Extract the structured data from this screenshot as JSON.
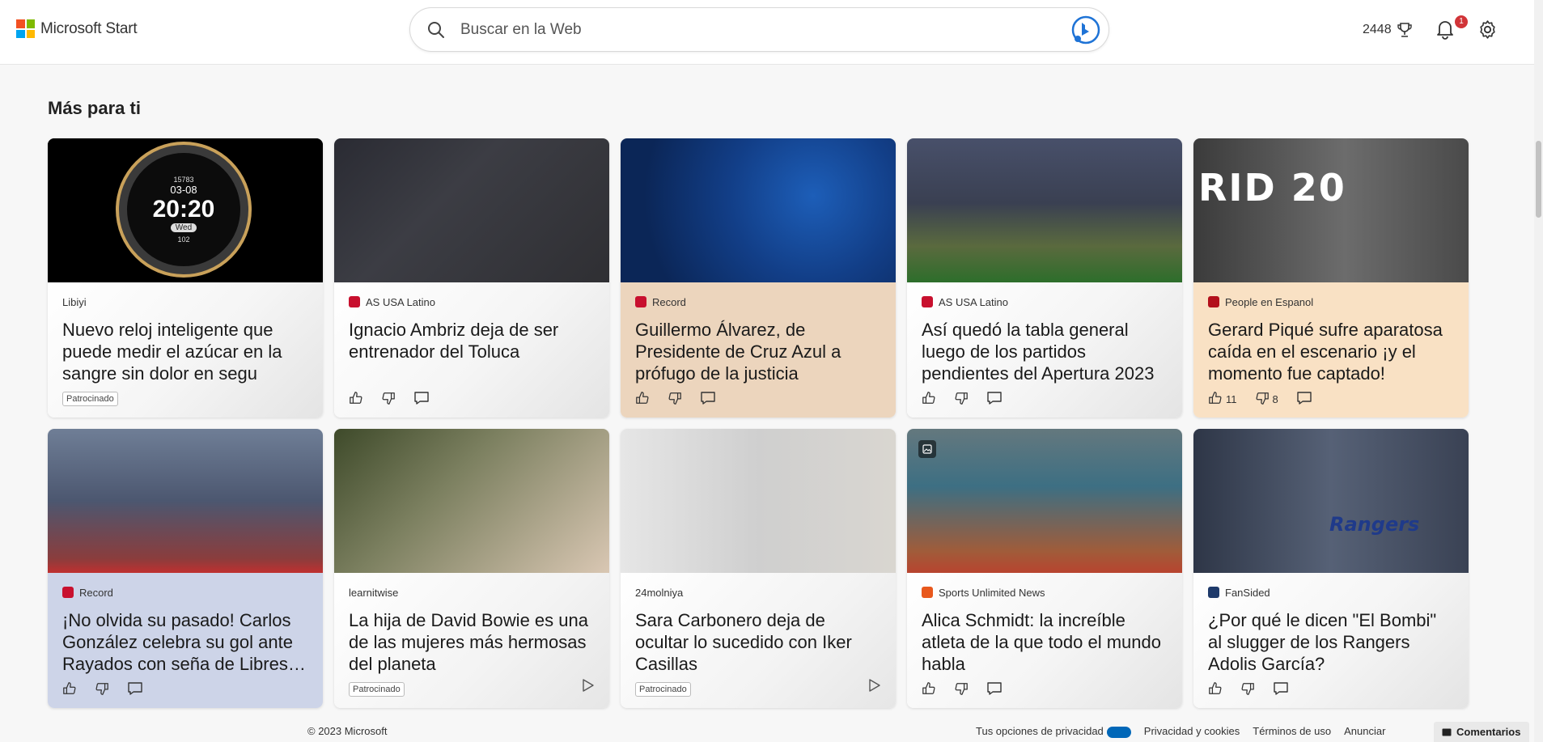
{
  "header": {
    "brand": "Microsoft Start",
    "search_placeholder": "Buscar en la Web",
    "points": "2448",
    "notification_count": "1"
  },
  "section_title": "Más para ti",
  "cards": [
    {
      "source": "Libiyi",
      "headline": "Nuevo reloj inteligente que puede medir el azúcar en la sangre sin dolor en segu",
      "sponsored": "Patrocinado",
      "bg": "b-white",
      "img": "im1",
      "watch_time": "20:20",
      "watch_date": "03-08",
      "watch_day": "Wed",
      "watch_steps": "15783",
      "watch_hr": "102"
    },
    {
      "source": "AS USA Latino",
      "headline": "Ignacio Ambriz deja de ser entrenador del Toluca",
      "bg": "b-white",
      "img": "im2",
      "fav_color": "#c8102e",
      "fav_text": "as"
    },
    {
      "source": "Record",
      "headline": "Guillermo Álvarez, de Presidente de Cruz Azul a prófugo de la justicia",
      "bg": "b-beige",
      "img": "im3",
      "fav_color": "#c8102e"
    },
    {
      "source": "AS USA Latino",
      "headline": "Así quedó la tabla general luego de los partidos pendientes del Apertura 2023",
      "bg": "b-white",
      "img": "im4",
      "fav_color": "#c8102e",
      "fav_text": "as"
    },
    {
      "source": "People en Espanol",
      "headline": "Gerard Piqué sufre aparatosa caída en el escenario ¡y el momento fue captado!",
      "bg": "b-peach",
      "img": "im5",
      "likes": "11",
      "dislikes": "8",
      "fav_color": "#b3101b",
      "img_text": "RID 20"
    },
    {
      "source": "Record",
      "headline": "¡No olvida su pasado! Carlos González celebra su gol ante Rayados con seña de Libres y Lokos",
      "bg": "b-lav",
      "img": "im6",
      "fav_color": "#c8102e"
    },
    {
      "source": "learnitwise",
      "headline": "La hija de David Bowie es una de las mujeres más hermosas del planeta",
      "sponsored": "Patrocinado",
      "bg": "b-grey",
      "img": "im7"
    },
    {
      "source": "24molniya",
      "headline": "Sara Carbonero deja de ocultar lo sucedido con Iker Casillas",
      "sponsored": "Patrocinado",
      "bg": "b-grey",
      "img": "im8"
    },
    {
      "source": "Sports Unlimited News",
      "headline": "Alica Schmidt: la increíble atleta de la que todo el mundo habla",
      "bg": "b-white",
      "img": "im9",
      "fav_color": "#e8581c"
    },
    {
      "source": "FanSided",
      "headline": "¿Por qué le dicen \"El Bombi\" al slugger de los Rangers Adolis García?",
      "bg": "b-white",
      "img": "im10",
      "fav_color": "#1f3a6b",
      "img_text": "Rangers"
    }
  ],
  "footer": {
    "copyright": "© 2023 Microsoft",
    "privacy_choices": "Tus opciones de privacidad",
    "privacy_cookies": "Privacidad y cookies",
    "terms": "Términos de uso",
    "advertise": "Anunciar",
    "feedback": "Comentarios"
  }
}
